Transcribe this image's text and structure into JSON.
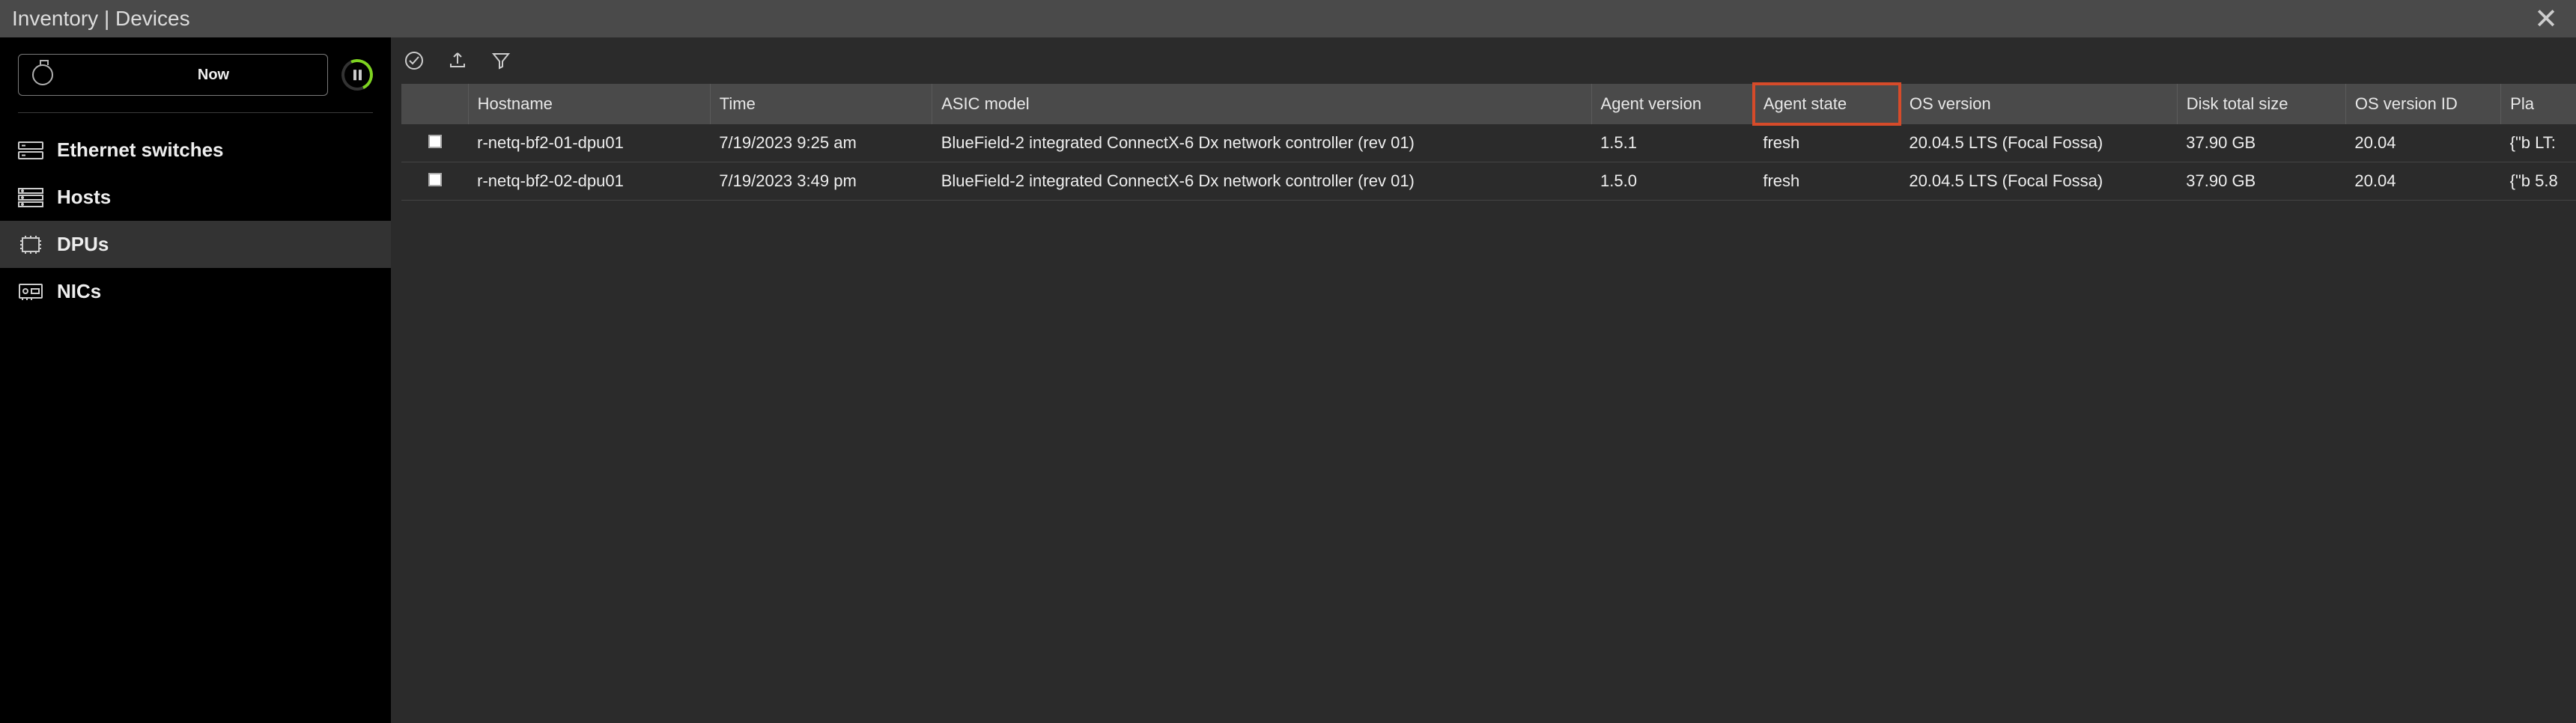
{
  "titlebar": {
    "title": "Inventory | Devices"
  },
  "sidebar": {
    "now_label": "Now",
    "items": [
      {
        "label": "Ethernet switches"
      },
      {
        "label": "Hosts"
      },
      {
        "label": "DPUs"
      },
      {
        "label": "NICs"
      }
    ]
  },
  "table": {
    "headers": {
      "hostname": "Hostname",
      "time": "Time",
      "asic": "ASIC model",
      "agent_version": "Agent version",
      "agent_state": "Agent state",
      "os_version": "OS version",
      "disk_total": "Disk total size",
      "os_version_id": "OS version ID",
      "platform": "Pla"
    },
    "rows": [
      {
        "hostname": "r-netq-bf2-01-dpu01",
        "time": "7/19/2023 9:25 am",
        "asic": "BlueField-2 integrated ConnectX-6 Dx network controller (rev 01)",
        "agent_version": "1.5.1",
        "agent_state": "fresh",
        "os_version": "20.04.5 LTS (Focal Fossa)",
        "disk_total": "37.90 GB",
        "os_version_id": "20.04",
        "platform": "{\"b LT:"
      },
      {
        "hostname": "r-netq-bf2-02-dpu01",
        "time": "7/19/2023 3:49 pm",
        "asic": "BlueField-2 integrated ConnectX-6 Dx network controller (rev 01)",
        "agent_version": "1.5.0",
        "agent_state": "fresh",
        "os_version": "20.04.5 LTS (Focal Fossa)",
        "disk_total": "37.90 GB",
        "os_version_id": "20.04",
        "platform": "{\"b 5.8"
      }
    ]
  }
}
